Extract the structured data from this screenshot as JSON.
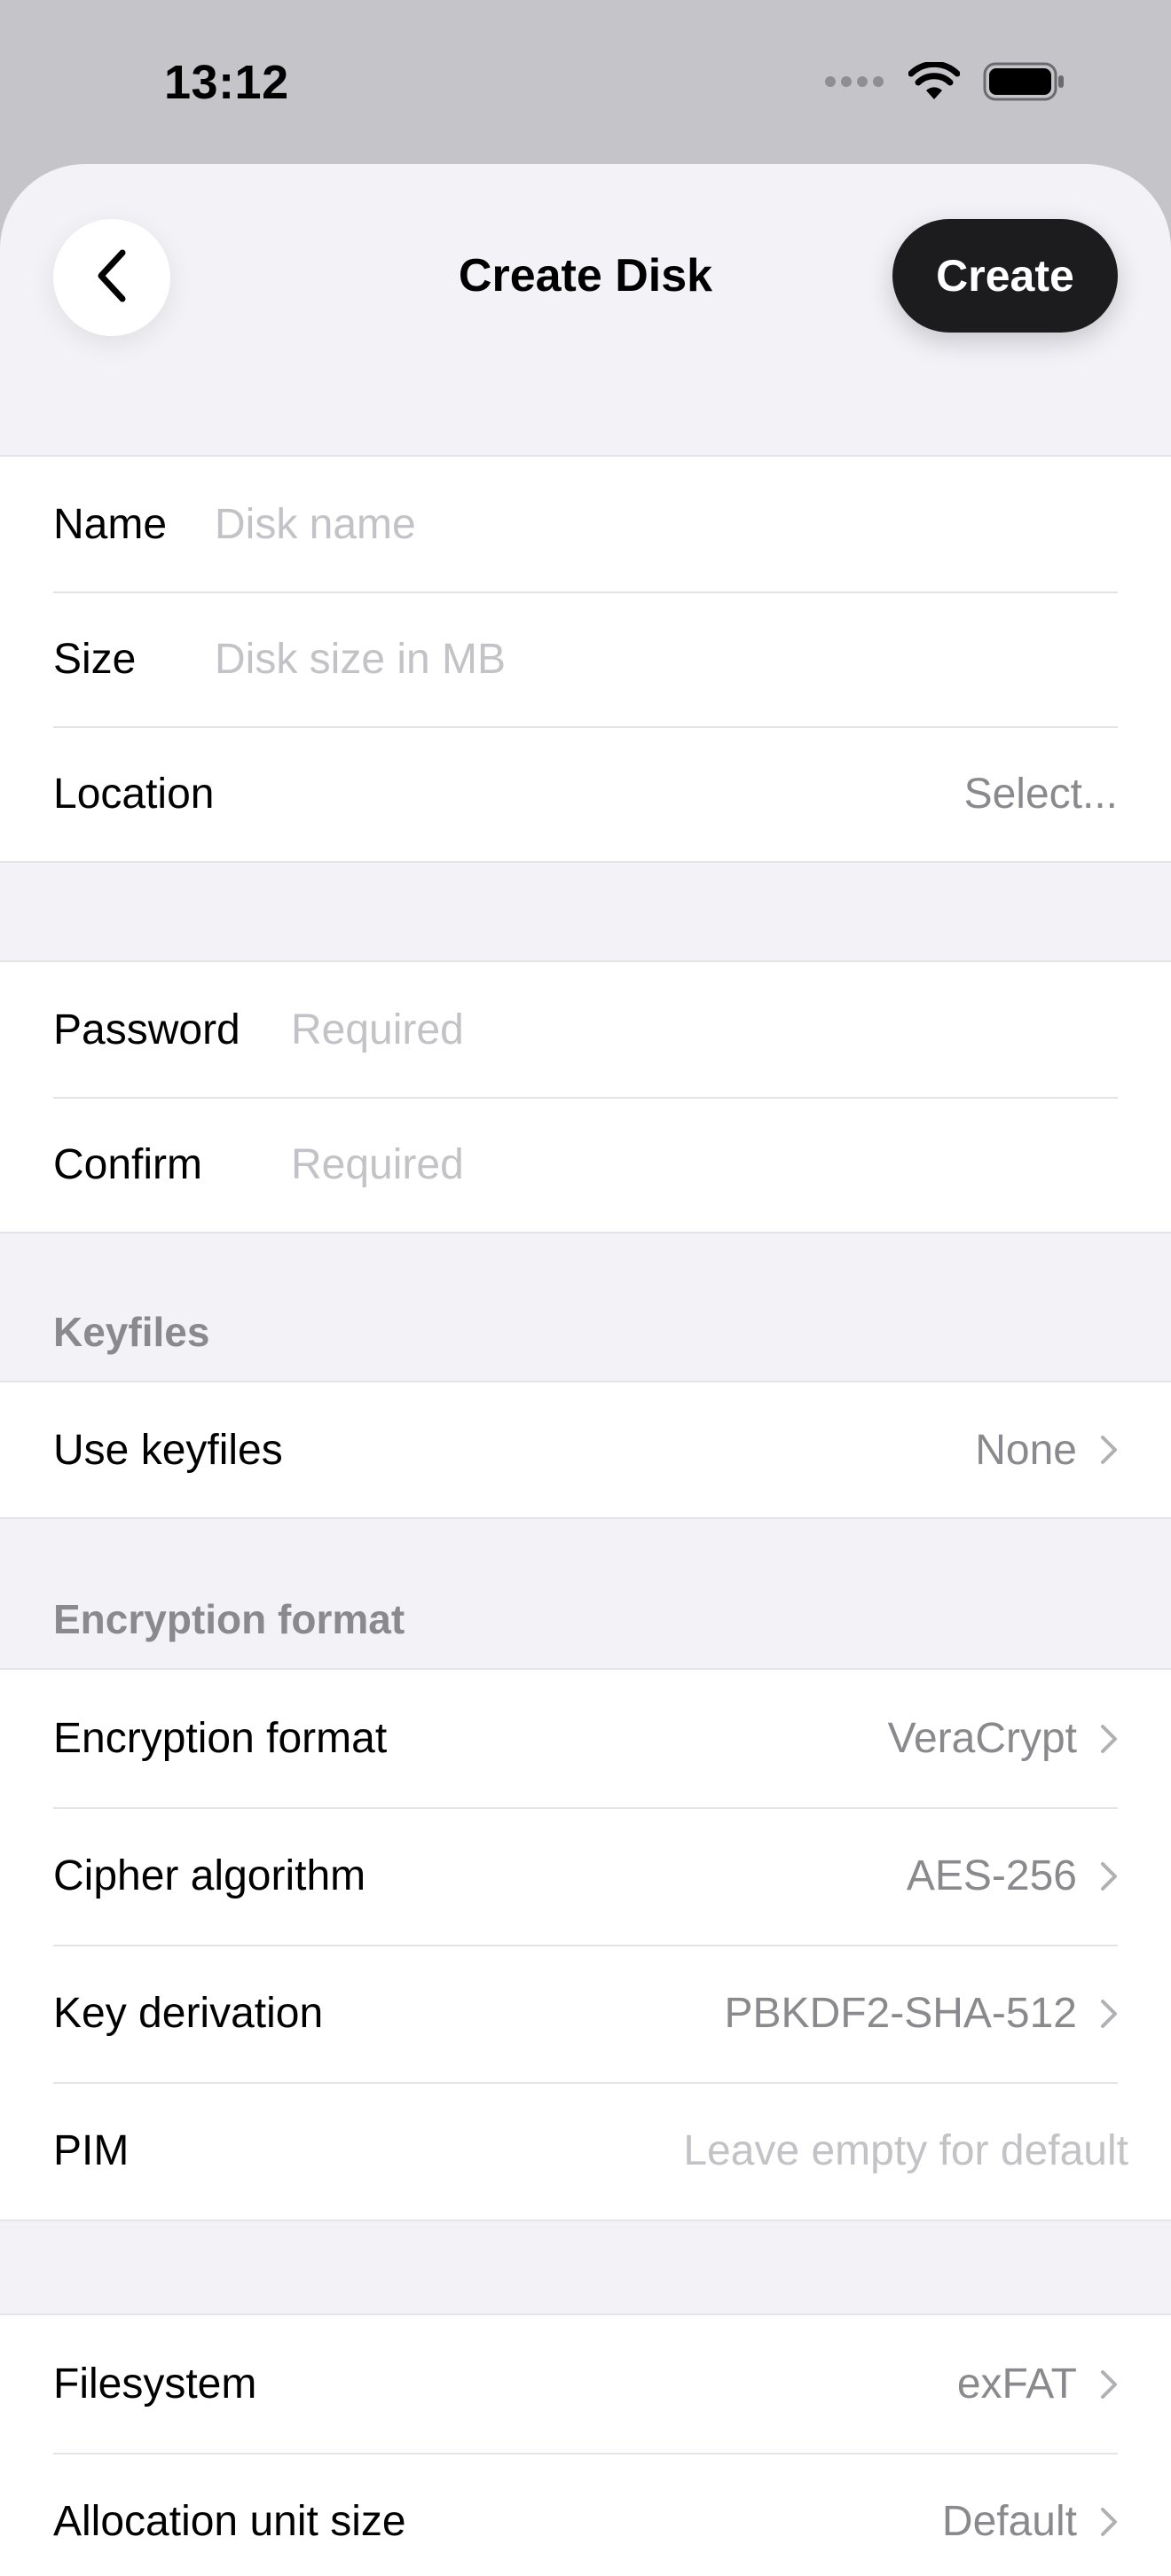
{
  "status_bar": {
    "time": "13:12"
  },
  "nav": {
    "title": "Create Disk",
    "create_label": "Create"
  },
  "basic": {
    "name_label": "Name",
    "name_placeholder": "Disk name",
    "size_label": "Size",
    "size_placeholder": "Disk size in MB",
    "location_label": "Location",
    "location_value": "Select..."
  },
  "security": {
    "password_label": "Password",
    "password_placeholder": "Required",
    "confirm_label": "Confirm",
    "confirm_placeholder": "Required"
  },
  "keyfiles": {
    "header": "Keyfiles",
    "use_label": "Use keyfiles",
    "use_value": "None"
  },
  "encryption": {
    "header": "Encryption format",
    "format_label": "Encryption format",
    "format_value": "VeraCrypt",
    "cipher_label": "Cipher algorithm",
    "cipher_value": "AES-256",
    "kdf_label": "Key derivation",
    "kdf_value": "PBKDF2-SHA-512",
    "pim_label": "PIM",
    "pim_placeholder": "Leave empty for default"
  },
  "filesystem": {
    "fs_label": "Filesystem",
    "fs_value": "exFAT",
    "alloc_label": "Allocation unit size",
    "alloc_value": "Default"
  },
  "icons": [
    "cellular-icon",
    "wifi-icon",
    "battery-icon",
    "chevron-left-icon",
    "chevron-right-icon"
  ]
}
